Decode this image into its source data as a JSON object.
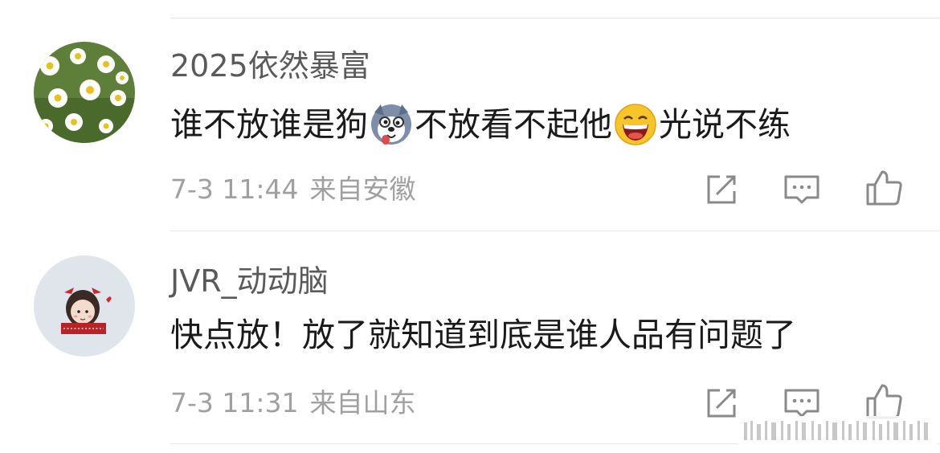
{
  "comments": [
    {
      "username": "2025依然暴富",
      "text_parts": [
        "谁不放谁是狗",
        "不放看不起他",
        "光说不练"
      ],
      "emojis": [
        "husky-dog-emoji",
        "laughing-face-emoji"
      ],
      "date": "7-3 11:44",
      "location": "来自安徽",
      "avatar": "daisy-flowers-avatar"
    },
    {
      "username": "JVR_动动脑",
      "text": "快点放！放了就知道到底是谁人品有问题了",
      "date": "7-3 11:31",
      "location": "来自山东",
      "avatar": "cartoon-girl-avatar"
    }
  ],
  "actions": {
    "icons": [
      "share-icon",
      "comment-icon",
      "like-icon"
    ]
  },
  "colors": {
    "username": "#5a5a5a",
    "text": "#1a1a1a",
    "meta": "#a0a0a0",
    "divider": "#e6e6e6",
    "icon": "#8a8a8a"
  }
}
